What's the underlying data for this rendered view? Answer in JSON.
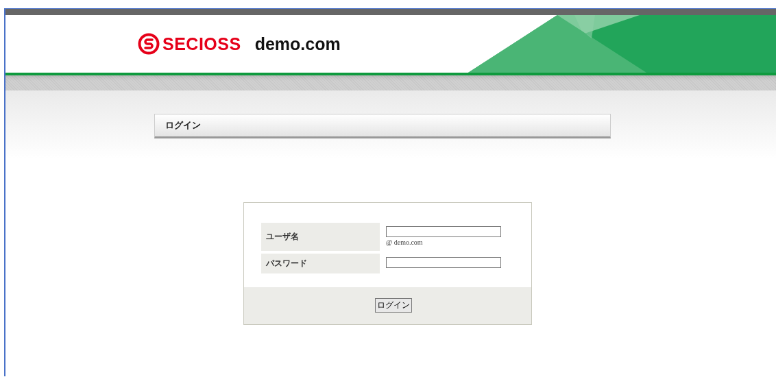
{
  "header": {
    "logo": "SECIOSS",
    "domain": "demo.com"
  },
  "section_title": "ログイン",
  "form": {
    "fields": [
      {
        "label": "ユーザ名",
        "suffix": "@ demo.com"
      },
      {
        "label": "パスワード"
      }
    ],
    "submit": "ログイン"
  }
}
